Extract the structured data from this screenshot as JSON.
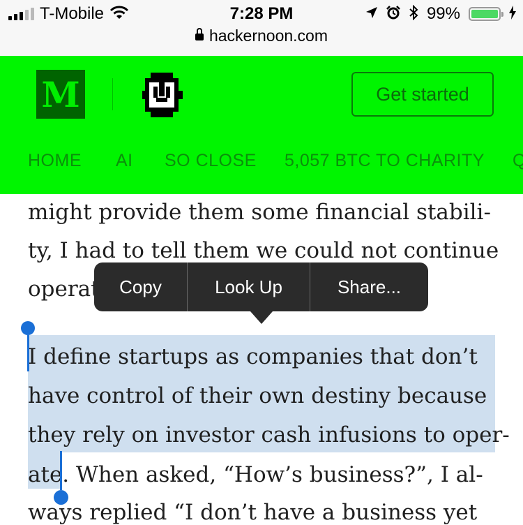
{
  "status_bar": {
    "carrier": "T-Mobile",
    "time": "7:28 PM",
    "battery_percent": "99%",
    "battery_level": 0.99,
    "url": "hackernoon.com",
    "icons": [
      "signal-icon",
      "wifi-icon",
      "location-arrow-icon",
      "alarm-icon",
      "bluetooth-icon",
      "battery-icon",
      "charging-icon",
      "lock-icon"
    ]
  },
  "header": {
    "logo_letter": "M",
    "cta_label": "Get started",
    "nav_items": [
      "HOME",
      "AI",
      "SO CLOSE",
      "5,057 BTC TO CHARITY",
      "Q"
    ],
    "background_color": "#00f500"
  },
  "article": {
    "lines": [
      "might provide them some financial stabili-",
      "ty, I had to tell them we could not continue",
      "operat",
      "I define startups as companies that don’t",
      "have control of their own destiny because",
      "they rely on investor cash infusions to oper-",
      "ate",
      ". When asked, “How’s business?”, I al-",
      "ways replied “I don’t have a business yet"
    ],
    "selection_color": "#cfdfef"
  },
  "callout_menu": {
    "copy_label": "Copy",
    "lookup_label": "Look Up",
    "share_label": "Share..."
  }
}
